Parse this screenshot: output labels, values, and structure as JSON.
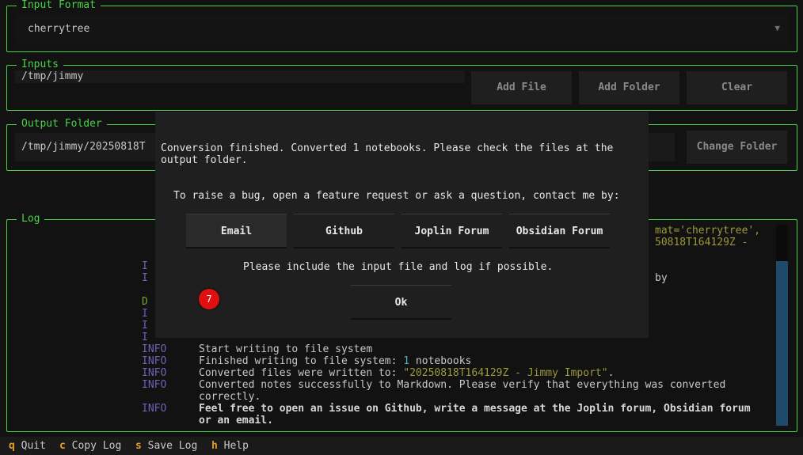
{
  "input_format": {
    "legend": "Input Format",
    "selected": "cherrytree",
    "arrow_icon": "▼"
  },
  "inputs": {
    "legend": "Inputs",
    "path": "/tmp/jimmy",
    "add_file": "Add File",
    "add_folder": "Add Folder",
    "clear": "Clear"
  },
  "output": {
    "legend": "Output Folder",
    "path": "/tmp/jimmy/20250818T",
    "change": "Change Folder"
  },
  "log": {
    "legend": "Log",
    "partial_right_1": "mat='cherrytree',",
    "partial_right_2": "50818T164129Z -",
    "partial_right_3": "by",
    "partial_levels": [
      "I",
      "I",
      "",
      "D",
      "I",
      "I",
      "I"
    ],
    "lines": [
      {
        "level": "INFO",
        "segments": [
          {
            "text": "Start writing to file system",
            "cls": ""
          }
        ]
      },
      {
        "level": "INFO",
        "segments": [
          {
            "text": "Finished writing to file system: ",
            "cls": ""
          },
          {
            "text": "1",
            "cls": "num"
          },
          {
            "text": " notebooks",
            "cls": ""
          }
        ]
      },
      {
        "level": "INFO",
        "segments": [
          {
            "text": "Converted files were written to: ",
            "cls": ""
          },
          {
            "text": "\"20250818T164129Z - Jimmy Import\"",
            "cls": "str"
          },
          {
            "text": ".",
            "cls": ""
          }
        ]
      },
      {
        "level": "INFO",
        "segments": [
          {
            "text": "Converted notes successfully to Markdown. Please verify that everything was converted",
            "cls": ""
          }
        ]
      },
      {
        "level": "",
        "segments": [
          {
            "text": "correctly.",
            "cls": ""
          }
        ]
      },
      {
        "level": "INFO",
        "segments": [
          {
            "text": "Feel free to open an issue on Github, write a message at the Joplin forum, Obsidian forum",
            "cls": "bold"
          }
        ]
      },
      {
        "level": "",
        "segments": [
          {
            "text": "or an email.",
            "cls": "bold"
          }
        ]
      }
    ]
  },
  "modal": {
    "message_1": "Conversion finished. Converted 1 notebooks. Please check the files at the",
    "message_2": "output folder.",
    "contact": "To raise a bug, open a feature request or ask a question, contact me by:",
    "buttons": [
      "Email",
      "Github",
      "Joplin Forum",
      "Obsidian Forum"
    ],
    "note": "Please include the input file and log if possible.",
    "ok": "Ok"
  },
  "badge": "7",
  "footer": [
    {
      "key": "q",
      "label": "Quit"
    },
    {
      "key": "c",
      "label": "Copy Log"
    },
    {
      "key": "s",
      "label": "Save Log"
    },
    {
      "key": "h",
      "label": "Help"
    }
  ],
  "colors": {
    "accent": "#4bd14b",
    "info": "#6c63b9",
    "debug": "#7aa32e",
    "key": "#e0a020",
    "badge": "#e01010"
  }
}
